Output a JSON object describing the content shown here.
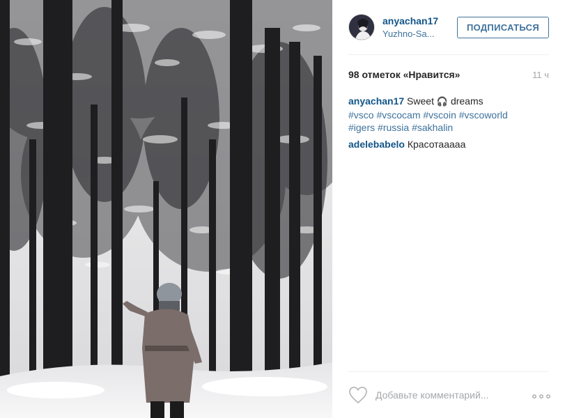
{
  "post": {
    "username": "anyachan17",
    "location": "Yuzhno-Sa...",
    "follow_label": "ПОДПИСАТЬСЯ",
    "likes": "98 отметок «Нравится»",
    "time_ago": "11 ч",
    "caption": {
      "username": "anyachan17",
      "text_before": " Sweet ",
      "emoji": "🎧",
      "text_after": " dreams",
      "hashtags": [
        "#vsco",
        "#vscocam",
        "#vscoin",
        "#vscoworld",
        "#igers",
        "#russia",
        "#sakhalin"
      ]
    },
    "comments": [
      {
        "username": "adelebabelo",
        "text": "Красотааааа"
      }
    ],
    "comment_placeholder": "Добавьте комментарий...",
    "more_icon": "ellipsis-icon",
    "like_icon": "heart-outline-icon"
  },
  "colors": {
    "username": "#125688",
    "link": "#3f729b",
    "muted": "#a5a7aa",
    "separator": "#efefef"
  }
}
